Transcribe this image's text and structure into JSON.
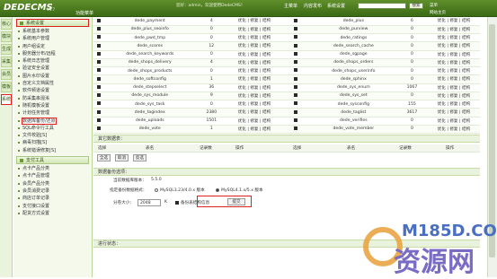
{
  "app": {
    "logo": "DEDECMS",
    "version": "V5.7",
    "main_tab": "功能菜单"
  },
  "topbar": {
    "user_text": "您好：admin，欢迎使用DedeCMS！",
    "nav": [
      "主菜单",
      "内容发布",
      "系统设置",
      "会员",
      "模板"
    ],
    "search_button": "搜索",
    "menu_view": "菜单",
    "small_nav": "网站主页"
  },
  "vtabs": [
    "核心",
    "模块",
    "生成",
    "采集",
    "会员",
    "模板",
    "系统"
  ],
  "sidebar": {
    "sections": [
      {
        "title": "系统设置",
        "items": [
          "系统基本参数",
          "系统用户管理",
          "用户组设定",
          "服务器分布/远程",
          "系统日志管理",
          "验证安全设置",
          "图片水印设置",
          "自定义文档属性",
          "软件频道设置",
          "防采集串混淆",
          "随机模板设置",
          "计划任务管理",
          "数据库备份/还原",
          "SQL命令行工具",
          "文件校验[S]",
          "病毒扫描[S]",
          "系统错误修复[S]"
        ]
      },
      {
        "title": "支付工具",
        "items": [
          "点卡产品分类",
          "点卡产品管理",
          "会员产品分类",
          "会员消费记录",
          "商店订单记录",
          "支付接口设置",
          "配货方式设置"
        ]
      }
    ]
  },
  "table": {
    "rows": [
      {
        "checked1": true,
        "name1": "dede_payment",
        "count1": "4",
        "ops1": "优化 | 修复 | 结构",
        "checked2": true,
        "name2": "dede_plus",
        "count2": "6",
        "ops2": "优化 | 修复 | 结构"
      },
      {
        "checked1": true,
        "name1": "dede_plus_seoinfo",
        "count1": "0",
        "ops1": "优化 | 修复 | 结构",
        "checked2": true,
        "name2": "dede_purview",
        "count2": "0",
        "ops2": "优化 | 修复 | 结构"
      },
      {
        "checked1": true,
        "name1": "dede_pwd_tmp",
        "count1": "0",
        "ops1": "优化 | 修复 | 结构",
        "checked2": true,
        "name2": "dede_ratings",
        "count2": "0",
        "ops2": "优化 | 修复 | 结构"
      },
      {
        "checked1": true,
        "name1": "dede_scores",
        "count1": "12",
        "ops1": "优化 | 修复 | 结构",
        "checked2": true,
        "name2": "dede_search_cache",
        "count2": "0",
        "ops2": "优化 | 修复 | 结构"
      },
      {
        "checked1": true,
        "name1": "dede_search_keywords",
        "count1": "0",
        "ops1": "优化 | 修复 | 结构",
        "checked2": true,
        "name2": "dede_sgpage",
        "count2": "0",
        "ops2": "优化 | 修复 | 结构"
      },
      {
        "checked1": true,
        "name1": "dede_shops_delivery",
        "count1": "4",
        "ops1": "优化 | 修复 | 结构",
        "checked2": true,
        "name2": "dede_shops_orders",
        "count2": "0",
        "ops2": "优化 | 修复 | 结构"
      },
      {
        "checked1": true,
        "name1": "dede_shops_products",
        "count1": "0",
        "ops1": "优化 | 修复 | 结构",
        "checked2": true,
        "name2": "dede_shops_userinfo",
        "count2": "0",
        "ops2": "优化 | 修复 | 结构"
      },
      {
        "checked1": true,
        "name1": "dede_softconfig",
        "count1": "1",
        "ops1": "优化 | 修复 | 结构",
        "checked2": true,
        "name2": "dede_sphinx",
        "count2": "0",
        "ops2": "优化 | 修复 | 结构"
      },
      {
        "checked1": true,
        "name1": "dede_stepselect",
        "count1": "36",
        "ops1": "优化 | 修复 | 结构",
        "checked2": true,
        "name2": "dede_sys_enum",
        "count2": "1067",
        "ops2": "优化 | 修复 | 结构"
      },
      {
        "checked1": true,
        "name1": "dede_sys_module",
        "count1": "9",
        "ops1": "优化 | 修复 | 结构",
        "checked2": true,
        "name2": "dede_sys_set",
        "count2": "0",
        "ops2": "优化 | 修复 | 结构"
      },
      {
        "checked1": true,
        "name1": "dede_sys_task",
        "count1": "0",
        "ops1": "优化 | 修复 | 结构",
        "checked2": true,
        "name2": "dede_sysconfig",
        "count2": "155",
        "ops2": "优化 | 修复 | 结构"
      },
      {
        "checked1": true,
        "name1": "dede_tagindex",
        "count1": "2380",
        "ops1": "优化 | 修复 | 结构",
        "checked2": true,
        "name2": "dede_taglist",
        "count2": "3617",
        "ops2": "优化 | 修复 | 结构"
      },
      {
        "checked1": true,
        "name1": "dede_uploads",
        "count1": "1501",
        "ops1": "优化 | 修复 | 结构",
        "checked2": true,
        "name2": "dede_verifies",
        "count2": "0",
        "ops2": "优化 | 修复 | 结构"
      },
      {
        "checked1": true,
        "name1": "dede_vote",
        "count1": "1",
        "ops1": "优化 | 修复 | 结构",
        "checked2": true,
        "name2": "dede_vote_member",
        "count2": "0",
        "ops2": "优化 | 修复 | 结构"
      }
    ]
  },
  "other_tables": {
    "title": "其它数据表：",
    "headers": [
      "选择",
      "表名",
      "记录数",
      "操作",
      "选择",
      "表名",
      "记录数",
      "操作"
    ],
    "buttons": [
      "全选",
      "取消",
      "反选"
    ]
  },
  "backup": {
    "title": "数据备份选项：",
    "mysql_label": "当前数据库版本：",
    "mysql_version": "5.5.0",
    "compat_label": "指定备份数据格式：",
    "opt_mysql3": "MySQL3.23/4.0.x 版本",
    "opt_mysql4": "MySQL4.1.x/5.x 版本",
    "size_label": "分卷大小：",
    "size_value": "2048",
    "size_unit": "K",
    "struct_label": "备份表结构信息",
    "submit": "提交"
  },
  "status": {
    "title": "进行状态："
  },
  "watermark": {
    "top": "M185D.COM",
    "bottom": "资源网"
  }
}
